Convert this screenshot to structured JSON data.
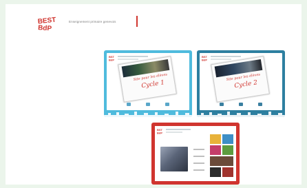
{
  "header": {
    "logo_text": "Best BdP",
    "title": "Enseignement primaire genevois"
  },
  "cards": [
    {
      "paper_note": "Site pour les élèves",
      "paper_title": "Cycle 1",
      "accent": "#4fbbdd"
    },
    {
      "paper_note": "Site pour les élèves",
      "paper_title": "Cycle 2",
      "accent": "#2d7fa0"
    }
  ],
  "teacher_card": {
    "accent": "#d0352f"
  },
  "colors": {
    "background": "#ebf5eb",
    "brand_red": "#d0352f"
  }
}
